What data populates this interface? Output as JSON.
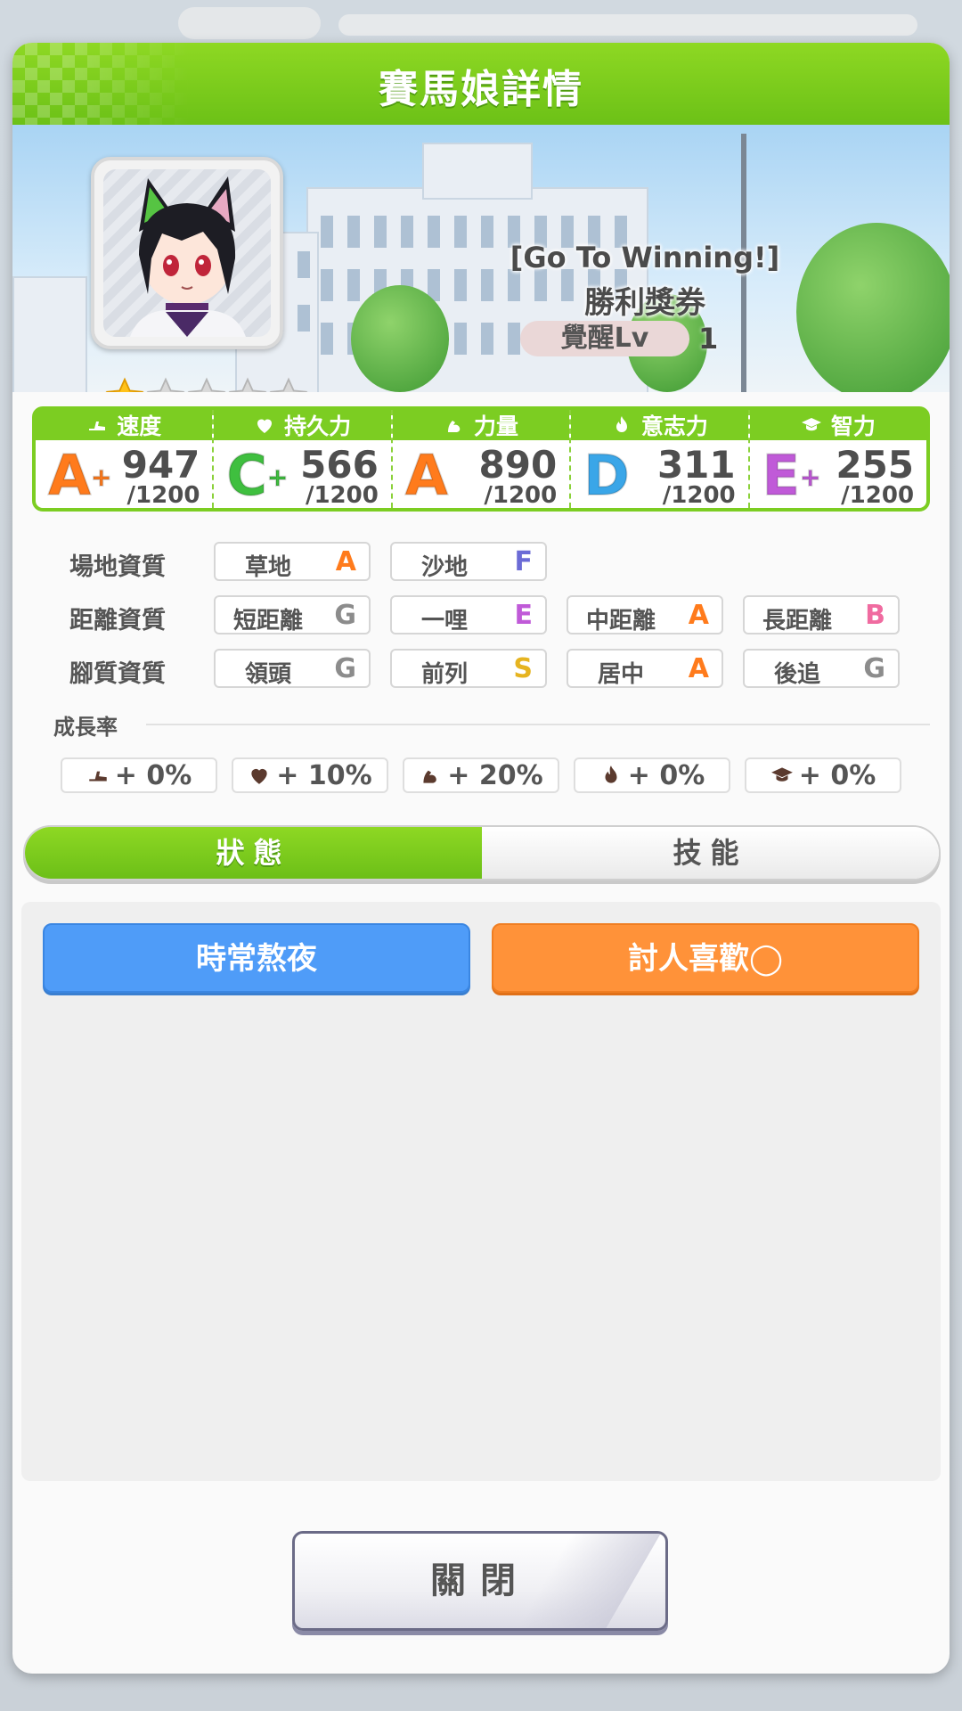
{
  "dialog": {
    "title": "賽馬娘詳情"
  },
  "card": {
    "title": "[Go To Winning!]",
    "name": "勝利獎券",
    "awake_label": "覺醒Lv",
    "awake_level": "1",
    "stars_total": 5,
    "stars_filled": 1
  },
  "stats": [
    {
      "label": "速度",
      "icon": "shoe-icon",
      "grade": "A",
      "plus": "+",
      "value": "947",
      "max": "/1200",
      "color": "#ff7b1c"
    },
    {
      "label": "持久力",
      "icon": "heart-icon",
      "grade": "C",
      "plus": "+",
      "value": "566",
      "max": "/1200",
      "color": "#3fbf3f"
    },
    {
      "label": "力量",
      "icon": "muscle-icon",
      "grade": "A",
      "plus": "",
      "value": "890",
      "max": "/1200",
      "color": "#ff7b1c"
    },
    {
      "label": "意志力",
      "icon": "flame-icon",
      "grade": "D",
      "plus": "",
      "value": "311",
      "max": "/1200",
      "color": "#3aa6e8"
    },
    {
      "label": "智力",
      "icon": "mortarboard-icon",
      "grade": "E",
      "plus": "+",
      "value": "255",
      "max": "/1200",
      "color": "#c05ad8"
    }
  ],
  "aptitude": {
    "track": {
      "label": "場地資質",
      "items": [
        {
          "name": "草地",
          "grade": "A",
          "color": "#ff7b1c"
        },
        {
          "name": "沙地",
          "grade": "F",
          "color": "#6b6bd6"
        }
      ]
    },
    "distance": {
      "label": "距離資質",
      "items": [
        {
          "name": "短距離",
          "grade": "G",
          "color": "#8c8c8c"
        },
        {
          "name": "一哩",
          "grade": "E",
          "color": "#c05ad8"
        },
        {
          "name": "中距離",
          "grade": "A",
          "color": "#ff7b1c"
        },
        {
          "name": "長距離",
          "grade": "B",
          "color": "#f06ba0"
        }
      ]
    },
    "style": {
      "label": "腳質資質",
      "items": [
        {
          "name": "領頭",
          "grade": "G",
          "color": "#8c8c8c"
        },
        {
          "name": "前列",
          "grade": "S",
          "color": "#e6b420"
        },
        {
          "name": "居中",
          "grade": "A",
          "color": "#ff7b1c"
        },
        {
          "name": "後追",
          "grade": "G",
          "color": "#8c8c8c"
        }
      ]
    }
  },
  "growth": {
    "label": "成長率",
    "items": [
      {
        "icon": "shoe-icon",
        "text": "+ 0%"
      },
      {
        "icon": "heart-icon",
        "text": "+ 10%"
      },
      {
        "icon": "muscle-icon",
        "text": "+ 20%"
      },
      {
        "icon": "flame-icon",
        "text": "+ 0%"
      },
      {
        "icon": "mortarboard-icon",
        "text": "+ 0%"
      }
    ]
  },
  "tabs": {
    "status": "狀態",
    "skills": "技能",
    "active": "status"
  },
  "conditions": [
    {
      "text": "時常熬夜",
      "color": "#4f9cf8"
    },
    {
      "text": "討人喜歡◯",
      "color": "#ff9239"
    }
  ],
  "close_label": "關閉"
}
